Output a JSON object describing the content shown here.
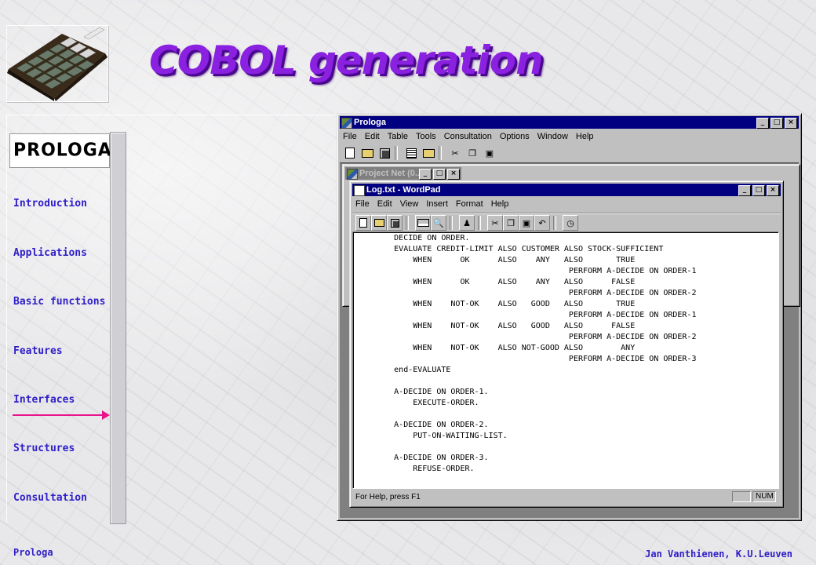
{
  "slide": {
    "title": "COBOL generation",
    "logo_text": "PROLOGA",
    "footer_left": "Prologa",
    "footer_right": "Jan Vanthienen, K.U.Leuven",
    "active_nav": "Interfaces",
    "accent_color": "#8a20e0",
    "nav_text_color": "#3020c8",
    "arrow_color": "#e8148c"
  },
  "nav": {
    "items": [
      {
        "label": "Introduction"
      },
      {
        "label": "Applications"
      },
      {
        "label": "Basic functions"
      },
      {
        "label": "Features"
      },
      {
        "label": "Interfaces"
      },
      {
        "label": "Structures"
      },
      {
        "label": "Consultation"
      }
    ]
  },
  "prologa_window": {
    "title": "Prologa",
    "menu": [
      "File",
      "Edit",
      "Table",
      "Tools",
      "Consultation",
      "Options",
      "Window",
      "Help"
    ],
    "title_buttons": [
      "_",
      "□",
      "×"
    ]
  },
  "project_window": {
    "title": "Project Net (0..."
  },
  "wordpad_window": {
    "title": "Log.txt - WordPad",
    "menu": [
      "File",
      "Edit",
      "View",
      "Insert",
      "Format",
      "Help"
    ],
    "status_text": "For Help, press F1",
    "status_num": "NUM",
    "code_lines": [
      "        DECIDE ON ORDER.",
      "        EVALUATE CREDIT-LIMIT ALSO CUSTOMER ALSO STOCK-SUFFICIENT",
      "            WHEN      OK      ALSO    ANY   ALSO       TRUE",
      "                                             PERFORM A-DECIDE ON ORDER-1",
      "            WHEN      OK      ALSO    ANY   ALSO      FALSE",
      "                                             PERFORM A-DECIDE ON ORDER-2",
      "            WHEN    NOT-OK    ALSO   GOOD   ALSO       TRUE",
      "                                             PERFORM A-DECIDE ON ORDER-1",
      "            WHEN    NOT-OK    ALSO   GOOD   ALSO      FALSE",
      "                                             PERFORM A-DECIDE ON ORDER-2",
      "            WHEN    NOT-OK    ALSO NOT-GOOD ALSO        ANY",
      "                                             PERFORM A-DECIDE ON ORDER-3",
      "        end-EVALUATE",
      "",
      "        A-DECIDE ON ORDER-1.",
      "            EXECUTE-ORDER.",
      "",
      "        A-DECIDE ON ORDER-2.",
      "            PUT-ON-WAITING-LIST.",
      "",
      "        A-DECIDE ON ORDER-3.",
      "            REFUSE-ORDER."
    ]
  }
}
